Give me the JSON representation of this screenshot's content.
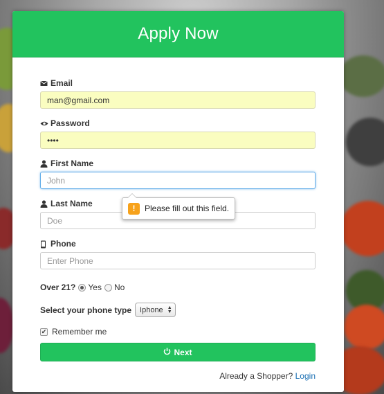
{
  "header": {
    "title": "Apply Now"
  },
  "form": {
    "email": {
      "label": "Email",
      "value": "man@gmail.com",
      "icon": "envelope-icon"
    },
    "password": {
      "label": "Password",
      "value": "••••",
      "icon": "eye-icon"
    },
    "first_name": {
      "label": "First Name",
      "placeholder": "John",
      "icon": "user-icon"
    },
    "last_name": {
      "label": "Last Name",
      "placeholder": "Doe",
      "icon": "user-icon"
    },
    "phone": {
      "label": "Phone",
      "placeholder": "Enter Phone",
      "icon": "mobile-phone-icon"
    },
    "over21": {
      "label": "Over 21?",
      "yes": "Yes",
      "no": "No",
      "selected": "Yes"
    },
    "phone_type": {
      "label": "Select your phone type",
      "selected": "Iphone"
    },
    "remember": {
      "label": "Remember me",
      "checked": true
    },
    "next_button": {
      "label": "Next",
      "icon": "power-icon"
    }
  },
  "validation_tooltip": {
    "message": "Please fill out this field.",
    "icon": "warning-icon"
  },
  "footer": {
    "text": "Already a Shopper?",
    "link": "Login"
  },
  "colors": {
    "accent": "#22c35e",
    "link": "#1a6fb3",
    "autofill": "#fafdc0",
    "warning": "#f7a21b"
  }
}
